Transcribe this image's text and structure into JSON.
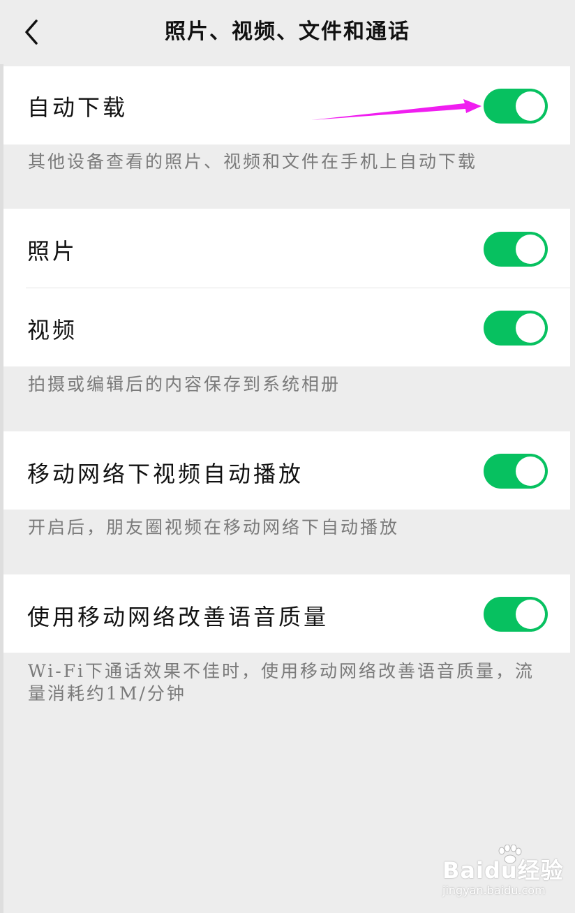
{
  "header": {
    "title": "照片、视频、文件和通话",
    "back_icon": "chevron-left-icon"
  },
  "sections": [
    {
      "rows": [
        {
          "label": "自动下载",
          "toggle_on": true
        }
      ],
      "note": "其他设备查看的照片、视频和文件在手机上自动下载"
    },
    {
      "rows": [
        {
          "label": "照片",
          "toggle_on": true
        },
        {
          "label": "视频",
          "toggle_on": true
        }
      ],
      "note": "拍摄或编辑后的内容保存到系统相册"
    },
    {
      "rows": [
        {
          "label": "移动网络下视频自动播放",
          "toggle_on": true
        }
      ],
      "note": "开启后，朋友圈视频在移动网络下自动播放"
    },
    {
      "rows": [
        {
          "label": "使用移动网络改善语音质量",
          "toggle_on": true
        }
      ],
      "note_lines": [
        "Wi-Fi下通话效果不佳时，使用移动网络改善语音质量，流",
        "量消耗约1M/分钟"
      ]
    }
  ],
  "annotation": {
    "arrow_color": "#f01ef0"
  },
  "watermark": {
    "logo_text": "Baidu经验",
    "url": "jingyan.baidu.com"
  },
  "colors": {
    "background": "#ededed",
    "card": "#ffffff",
    "toggle_on": "#07c160",
    "note_text": "#7a7a7a"
  }
}
